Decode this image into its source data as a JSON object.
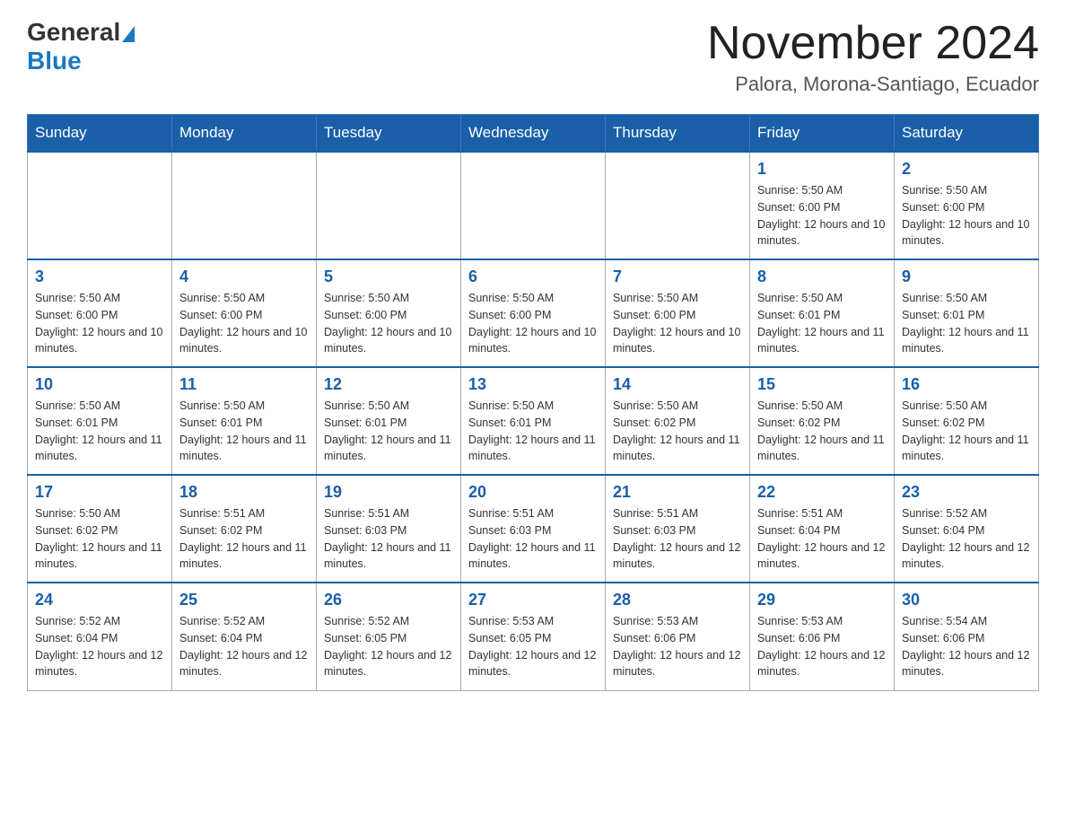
{
  "logo": {
    "general": "General",
    "blue": "Blue"
  },
  "title": "November 2024",
  "subtitle": "Palora, Morona-Santiago, Ecuador",
  "days_of_week": [
    "Sunday",
    "Monday",
    "Tuesday",
    "Wednesday",
    "Thursday",
    "Friday",
    "Saturday"
  ],
  "weeks": [
    [
      {
        "day": "",
        "sunrise": "",
        "sunset": "",
        "daylight": ""
      },
      {
        "day": "",
        "sunrise": "",
        "sunset": "",
        "daylight": ""
      },
      {
        "day": "",
        "sunrise": "",
        "sunset": "",
        "daylight": ""
      },
      {
        "day": "",
        "sunrise": "",
        "sunset": "",
        "daylight": ""
      },
      {
        "day": "",
        "sunrise": "",
        "sunset": "",
        "daylight": ""
      },
      {
        "day": "1",
        "sunrise": "Sunrise: 5:50 AM",
        "sunset": "Sunset: 6:00 PM",
        "daylight": "Daylight: 12 hours and 10 minutes."
      },
      {
        "day": "2",
        "sunrise": "Sunrise: 5:50 AM",
        "sunset": "Sunset: 6:00 PM",
        "daylight": "Daylight: 12 hours and 10 minutes."
      }
    ],
    [
      {
        "day": "3",
        "sunrise": "Sunrise: 5:50 AM",
        "sunset": "Sunset: 6:00 PM",
        "daylight": "Daylight: 12 hours and 10 minutes."
      },
      {
        "day": "4",
        "sunrise": "Sunrise: 5:50 AM",
        "sunset": "Sunset: 6:00 PM",
        "daylight": "Daylight: 12 hours and 10 minutes."
      },
      {
        "day": "5",
        "sunrise": "Sunrise: 5:50 AM",
        "sunset": "Sunset: 6:00 PM",
        "daylight": "Daylight: 12 hours and 10 minutes."
      },
      {
        "day": "6",
        "sunrise": "Sunrise: 5:50 AM",
        "sunset": "Sunset: 6:00 PM",
        "daylight": "Daylight: 12 hours and 10 minutes."
      },
      {
        "day": "7",
        "sunrise": "Sunrise: 5:50 AM",
        "sunset": "Sunset: 6:00 PM",
        "daylight": "Daylight: 12 hours and 10 minutes."
      },
      {
        "day": "8",
        "sunrise": "Sunrise: 5:50 AM",
        "sunset": "Sunset: 6:01 PM",
        "daylight": "Daylight: 12 hours and 11 minutes."
      },
      {
        "day": "9",
        "sunrise": "Sunrise: 5:50 AM",
        "sunset": "Sunset: 6:01 PM",
        "daylight": "Daylight: 12 hours and 11 minutes."
      }
    ],
    [
      {
        "day": "10",
        "sunrise": "Sunrise: 5:50 AM",
        "sunset": "Sunset: 6:01 PM",
        "daylight": "Daylight: 12 hours and 11 minutes."
      },
      {
        "day": "11",
        "sunrise": "Sunrise: 5:50 AM",
        "sunset": "Sunset: 6:01 PM",
        "daylight": "Daylight: 12 hours and 11 minutes."
      },
      {
        "day": "12",
        "sunrise": "Sunrise: 5:50 AM",
        "sunset": "Sunset: 6:01 PM",
        "daylight": "Daylight: 12 hours and 11 minutes."
      },
      {
        "day": "13",
        "sunrise": "Sunrise: 5:50 AM",
        "sunset": "Sunset: 6:01 PM",
        "daylight": "Daylight: 12 hours and 11 minutes."
      },
      {
        "day": "14",
        "sunrise": "Sunrise: 5:50 AM",
        "sunset": "Sunset: 6:02 PM",
        "daylight": "Daylight: 12 hours and 11 minutes."
      },
      {
        "day": "15",
        "sunrise": "Sunrise: 5:50 AM",
        "sunset": "Sunset: 6:02 PM",
        "daylight": "Daylight: 12 hours and 11 minutes."
      },
      {
        "day": "16",
        "sunrise": "Sunrise: 5:50 AM",
        "sunset": "Sunset: 6:02 PM",
        "daylight": "Daylight: 12 hours and 11 minutes."
      }
    ],
    [
      {
        "day": "17",
        "sunrise": "Sunrise: 5:50 AM",
        "sunset": "Sunset: 6:02 PM",
        "daylight": "Daylight: 12 hours and 11 minutes."
      },
      {
        "day": "18",
        "sunrise": "Sunrise: 5:51 AM",
        "sunset": "Sunset: 6:02 PM",
        "daylight": "Daylight: 12 hours and 11 minutes."
      },
      {
        "day": "19",
        "sunrise": "Sunrise: 5:51 AM",
        "sunset": "Sunset: 6:03 PM",
        "daylight": "Daylight: 12 hours and 11 minutes."
      },
      {
        "day": "20",
        "sunrise": "Sunrise: 5:51 AM",
        "sunset": "Sunset: 6:03 PM",
        "daylight": "Daylight: 12 hours and 11 minutes."
      },
      {
        "day": "21",
        "sunrise": "Sunrise: 5:51 AM",
        "sunset": "Sunset: 6:03 PM",
        "daylight": "Daylight: 12 hours and 12 minutes."
      },
      {
        "day": "22",
        "sunrise": "Sunrise: 5:51 AM",
        "sunset": "Sunset: 6:04 PM",
        "daylight": "Daylight: 12 hours and 12 minutes."
      },
      {
        "day": "23",
        "sunrise": "Sunrise: 5:52 AM",
        "sunset": "Sunset: 6:04 PM",
        "daylight": "Daylight: 12 hours and 12 minutes."
      }
    ],
    [
      {
        "day": "24",
        "sunrise": "Sunrise: 5:52 AM",
        "sunset": "Sunset: 6:04 PM",
        "daylight": "Daylight: 12 hours and 12 minutes."
      },
      {
        "day": "25",
        "sunrise": "Sunrise: 5:52 AM",
        "sunset": "Sunset: 6:04 PM",
        "daylight": "Daylight: 12 hours and 12 minutes."
      },
      {
        "day": "26",
        "sunrise": "Sunrise: 5:52 AM",
        "sunset": "Sunset: 6:05 PM",
        "daylight": "Daylight: 12 hours and 12 minutes."
      },
      {
        "day": "27",
        "sunrise": "Sunrise: 5:53 AM",
        "sunset": "Sunset: 6:05 PM",
        "daylight": "Daylight: 12 hours and 12 minutes."
      },
      {
        "day": "28",
        "sunrise": "Sunrise: 5:53 AM",
        "sunset": "Sunset: 6:06 PM",
        "daylight": "Daylight: 12 hours and 12 minutes."
      },
      {
        "day": "29",
        "sunrise": "Sunrise: 5:53 AM",
        "sunset": "Sunset: 6:06 PM",
        "daylight": "Daylight: 12 hours and 12 minutes."
      },
      {
        "day": "30",
        "sunrise": "Sunrise: 5:54 AM",
        "sunset": "Sunset: 6:06 PM",
        "daylight": "Daylight: 12 hours and 12 minutes."
      }
    ]
  ]
}
